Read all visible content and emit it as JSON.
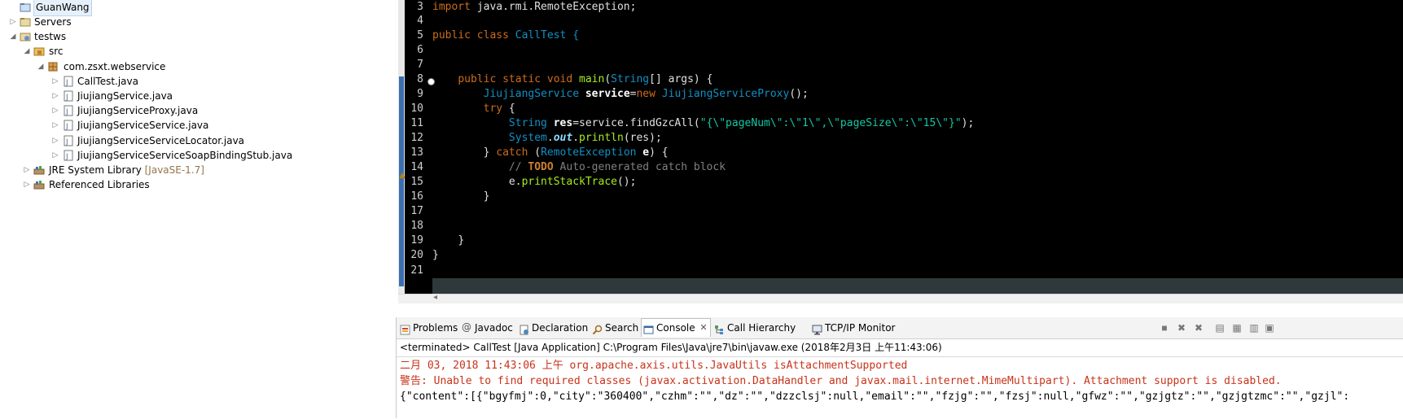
{
  "explorer": {
    "items": [
      {
        "label": "GuanWang",
        "deco": ""
      },
      {
        "label": "Servers",
        "deco": ""
      },
      {
        "label": "testws",
        "deco": ""
      },
      {
        "label": "src",
        "deco": ""
      },
      {
        "label": "com.zsxt.webservice",
        "deco": ""
      },
      {
        "label": "CallTest.java",
        "deco": ""
      },
      {
        "label": "JiujiangService.java",
        "deco": ""
      },
      {
        "label": "JiujiangServiceProxy.java",
        "deco": ""
      },
      {
        "label": "JiujiangServiceService.java",
        "deco": ""
      },
      {
        "label": "JiujiangServiceServiceLocator.java",
        "deco": ""
      },
      {
        "label": "JiujiangServiceServiceSoapBindingStub.java",
        "deco": ""
      },
      {
        "label": "JRE System Library",
        "deco": "[JavaSE-1.7]"
      },
      {
        "label": "Referenced Libraries",
        "deco": ""
      }
    ]
  },
  "editor": {
    "line_numbers": [
      "3",
      "4",
      "5",
      "6",
      "7",
      "8",
      "9",
      "10",
      "11",
      "12",
      "13",
      "14",
      "15",
      "16",
      "17",
      "18",
      "19",
      "20",
      "21"
    ],
    "code": {
      "l3_kw": "import",
      "l3_rest": " java.rmi.RemoteException;",
      "l5_kw": "public class",
      "l5_name": " CallTest {",
      "l8_kw": "public static void",
      "l8_main": " main",
      "l8_p1": "(",
      "l8_type": "String",
      "l8_p2": "[] args) {",
      "l9_type": "JiujiangService",
      "l9_var": "service",
      "l9_eq": "=",
      "l9_new": "new",
      "l9_type2": " JiujiangServiceProxy",
      "l9_end": "();",
      "l10_kw": "try",
      "l10_end": " {",
      "l11_type": "String",
      "l11_var": "res",
      "l11_mid": "=service.findGzcAll(",
      "l11_str": "\"{\\\"pageNum\\\":\\\"1\\\",\\\"pageSize\\\":\\\"15\\\"}\"",
      "l11_end": ");",
      "l12_type": "System",
      "l12_dot": ".",
      "l12_out": "out",
      "l12_dot2": ".",
      "l12_meth": "println",
      "l12_end": "(res);",
      "l13_pre": "} ",
      "l13_kw": "catch",
      "l13_p": " (",
      "l13_type": "RemoteException",
      "l13_var": " e",
      "l13_end": ") {",
      "l14_cmt": "// ",
      "l14_todo": "TODO",
      "l14_rest": " Auto-generated catch block",
      "l15_a": "e.",
      "l15_meth": "printStackTrace",
      "l15_end": "();",
      "l16": "}",
      "l19": "}",
      "l20": "}"
    }
  },
  "views": {
    "tabs": [
      "Problems",
      "Javadoc",
      "Declaration",
      "Search",
      "Console",
      "Call Hierarchy",
      "TCP/IP Monitor"
    ],
    "status": "<terminated> CallTest [Java Application] C:\\Program Files\\Java\\jre7\\bin\\javaw.exe (2018年2月3日 上午11:43:06)",
    "console_lines": [
      "二月 03, 2018 11:43:06 上午 org.apache.axis.utils.JavaUtils isAttachmentSupported",
      "警告: Unable to find required classes (javax.activation.DataHandler and javax.mail.internet.MimeMultipart). Attachment support is disabled.",
      "{\"content\":[{\"bgyfmj\":0,\"city\":\"360400\",\"czhm\":\"\",\"dz\":\"\",\"dzzclsj\":null,\"email\":\"\",\"fzjg\":\"\",\"fzsj\":null,\"gfwz\":\"\",\"gzjgtz\":\"\",\"gzjgtzmc\":\"\",\"gzjl\":"
    ]
  },
  "colors": {
    "editor_bg": "#000000",
    "keyword": "#cc6c1d",
    "type": "#1290c3",
    "string": "#17c6a3",
    "method": "#a7ec21",
    "console_error": "#c8331b"
  }
}
